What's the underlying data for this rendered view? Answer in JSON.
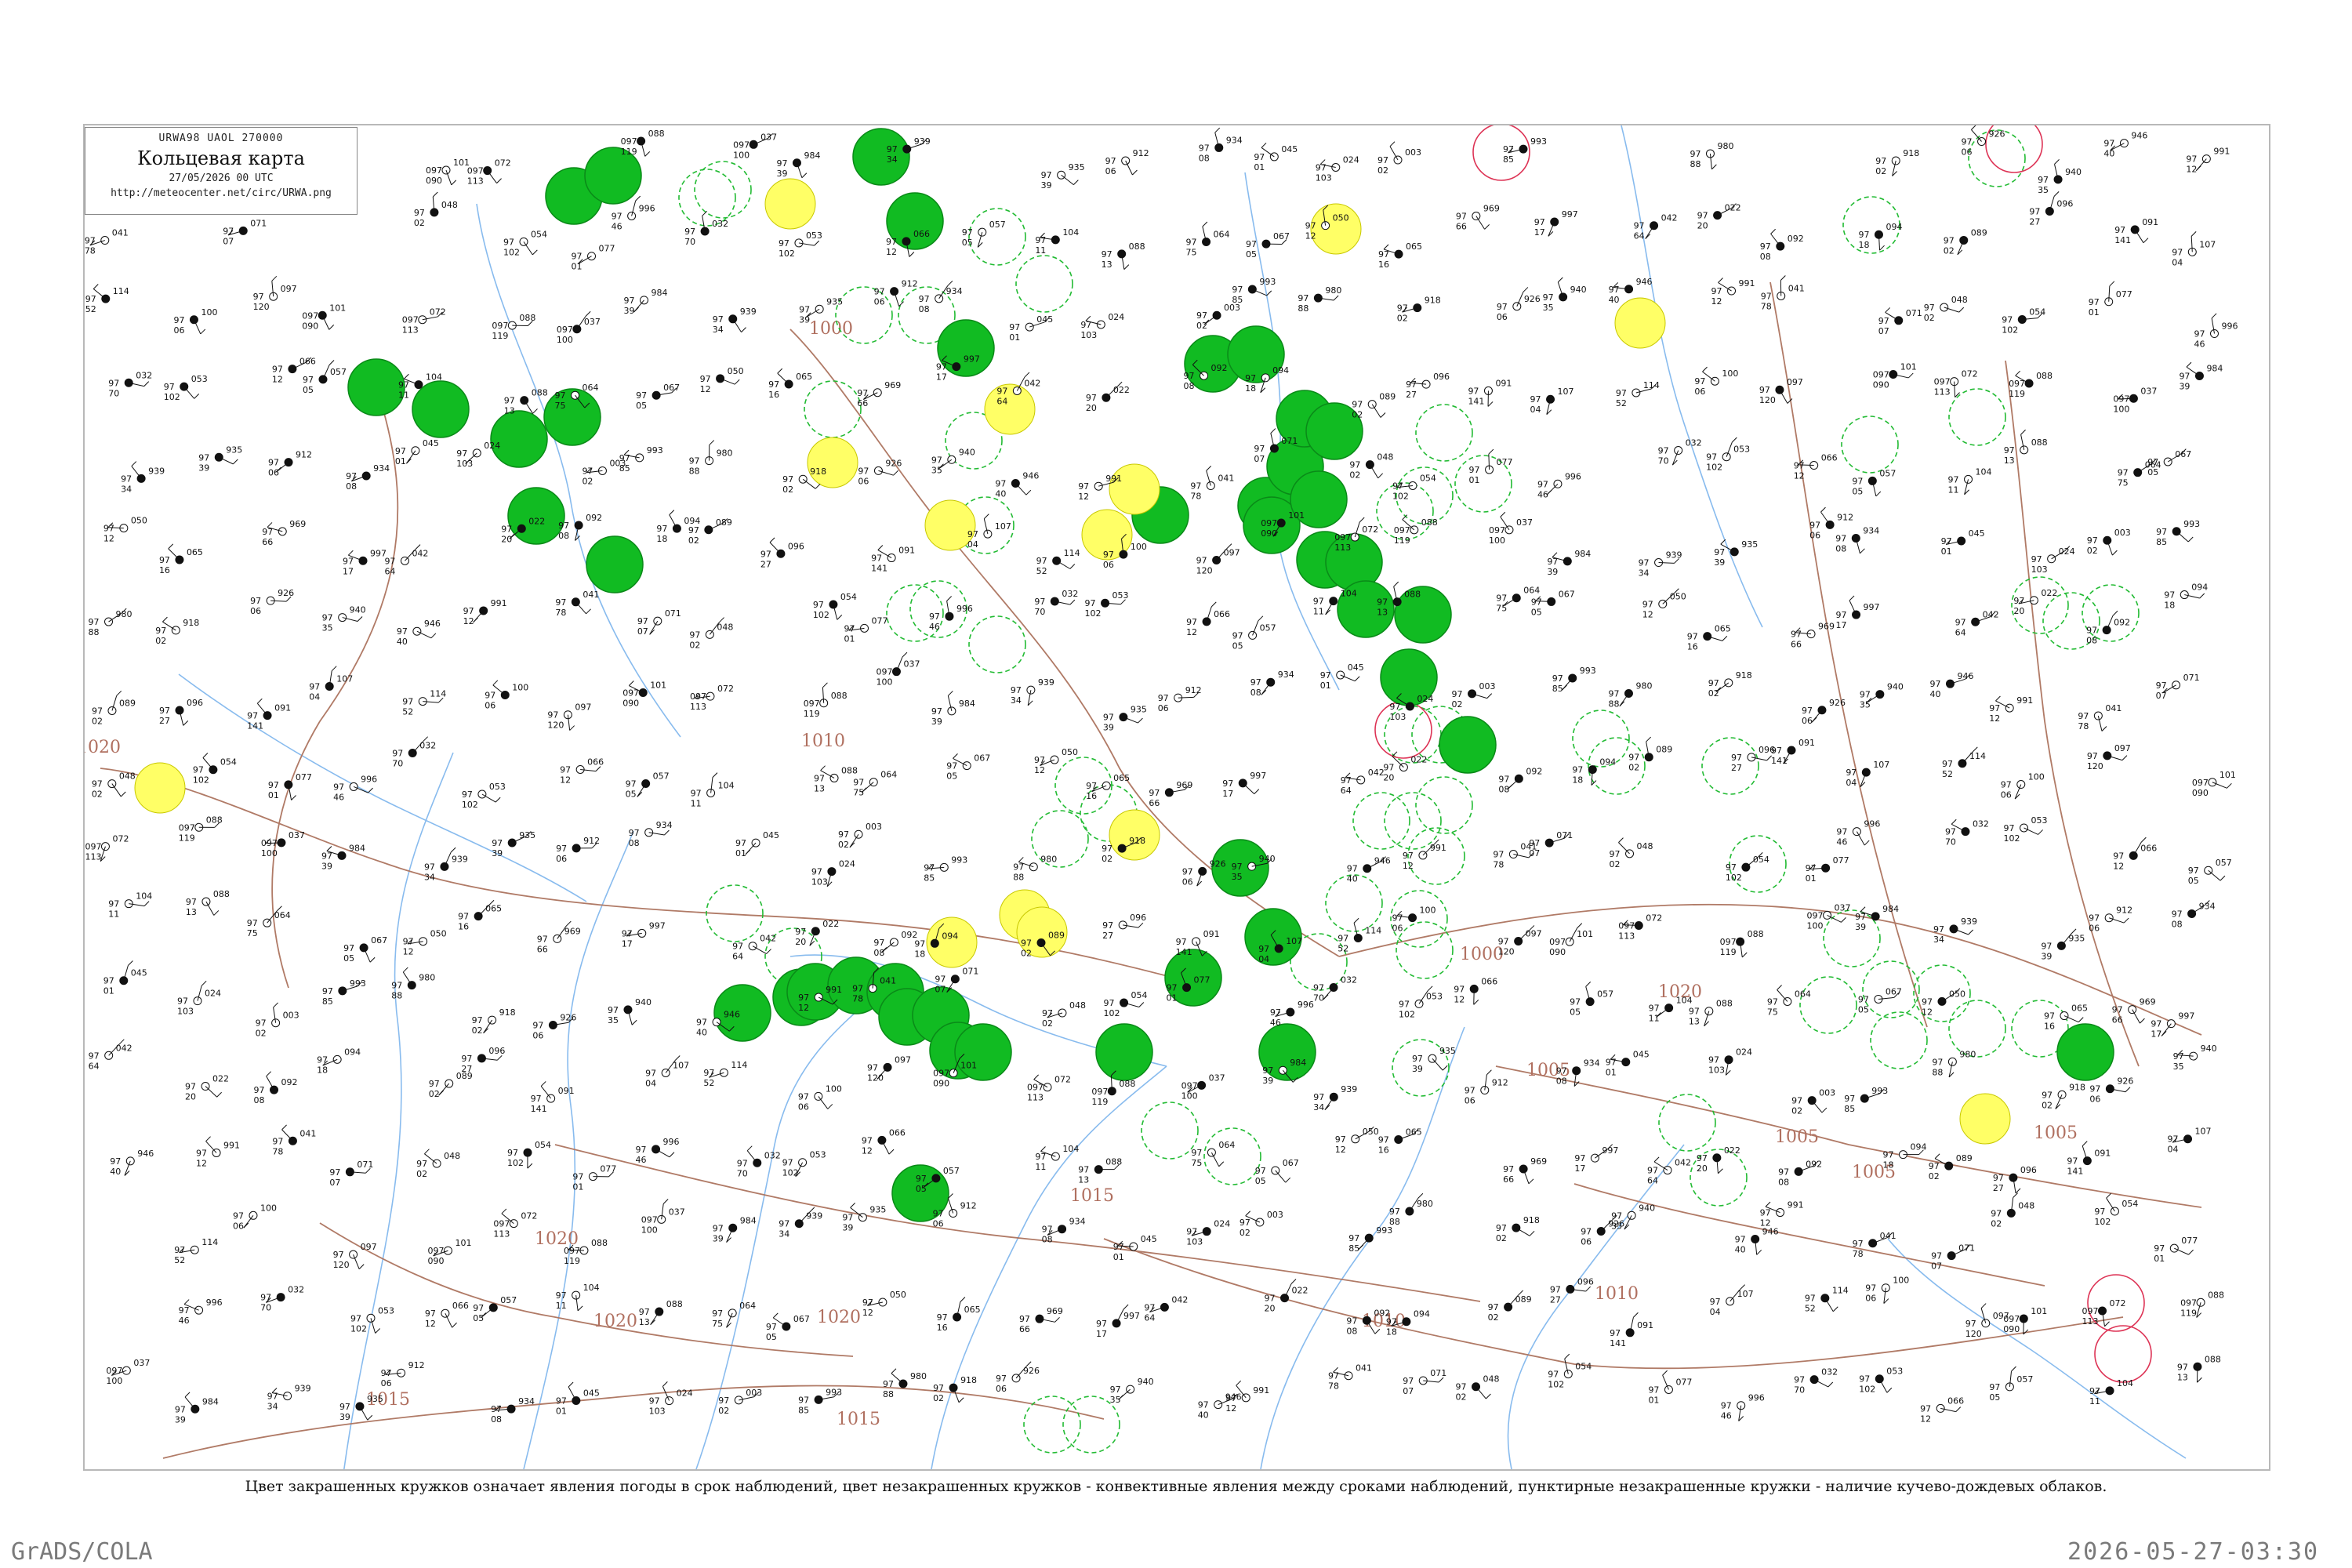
{
  "header": {
    "code": "URWA98  UAOL  270000",
    "title": "Кольцевая карта",
    "date": "27/05/2026 00 UTC",
    "url": "http://meteocenter.net/circ/URWA.png"
  },
  "caption": "Цвет закрашенных кружков означает явления погоды в срок наблюдений, цвет незакрашенных кружков - конвективные явления между сроками наблюдений, пунктирные незакрашенные кружки - наличие кучево-дождевых облаков.",
  "footer": {
    "left": "GrADS/COLA",
    "right": "2026-05-27-03:30"
  },
  "colors": {
    "green_fill": "#11bb22",
    "yellow_fill": "#ffff66",
    "isobar": "#b07a66",
    "river": "#88bbee",
    "ring_green": "#22bb33",
    "ring_red": "#dd3355"
  },
  "isobar_labels": [
    "1000",
    "1000",
    "1005",
    "1005",
    "1005",
    "1005",
    "1010",
    "1010",
    "1010",
    "1015",
    "1015",
    "1015",
    "1020",
    "1020",
    "1020",
    "1020",
    "1020"
  ],
  "stations": [
    {
      "p": "101",
      "t": "097",
      "d": "090"
    },
    {
      "p": "072",
      "t": "097",
      "d": "113"
    },
    {
      "p": "088",
      "t": "097",
      "d": "119"
    },
    {
      "p": "037",
      "t": "097",
      "d": "100"
    },
    {
      "p": "984",
      "t": "97",
      "d": "39"
    },
    {
      "p": "939",
      "t": "97",
      "d": "34"
    },
    {
      "p": "935",
      "t": "97",
      "d": "39"
    },
    {
      "p": "912",
      "t": "97",
      "d": "06"
    },
    {
      "p": "934",
      "t": "97",
      "d": "08"
    },
    {
      "p": "045",
      "t": "97",
      "d": "01"
    },
    {
      "p": "024",
      "t": "97",
      "d": "103"
    },
    {
      "p": "003",
      "t": "97",
      "d": "02"
    },
    {
      "p": "993",
      "t": "97",
      "d": "85"
    },
    {
      "p": "980",
      "t": "97",
      "d": "88"
    },
    {
      "p": "918",
      "t": "97",
      "d": "02"
    },
    {
      "p": "926",
      "t": "97",
      "d": "06"
    },
    {
      "p": "940",
      "t": "97",
      "d": "35"
    },
    {
      "p": "946",
      "t": "97",
      "d": "40"
    },
    {
      "p": "991",
      "t": "97",
      "d": "12"
    },
    {
      "p": "041",
      "t": "97",
      "d": "78"
    },
    {
      "p": "071",
      "t": "97",
      "d": "07"
    },
    {
      "p": "048",
      "t": "97",
      "d": "02"
    },
    {
      "p": "054",
      "t": "97",
      "d": "102"
    },
    {
      "p": "077",
      "t": "97",
      "d": "01"
    },
    {
      "p": "996",
      "t": "97",
      "d": "46"
    },
    {
      "p": "032",
      "t": "97",
      "d": "70"
    },
    {
      "p": "053",
      "t": "97",
      "d": "102"
    },
    {
      "p": "066",
      "t": "97",
      "d": "12"
    },
    {
      "p": "057",
      "t": "97",
      "d": "05"
    },
    {
      "p": "104",
      "t": "97",
      "d": "11"
    },
    {
      "p": "088",
      "t": "97",
      "d": "13"
    },
    {
      "p": "064",
      "t": "97",
      "d": "75"
    },
    {
      "p": "067",
      "t": "97",
      "d": "05"
    },
    {
      "p": "050",
      "t": "97",
      "d": "12"
    },
    {
      "p": "065",
      "t": "97",
      "d": "16"
    },
    {
      "p": "969",
      "t": "97",
      "d": "66"
    },
    {
      "p": "997",
      "t": "97",
      "d": "17"
    },
    {
      "p": "042",
      "t": "97",
      "d": "64"
    },
    {
      "p": "022",
      "t": "97",
      "d": "20"
    },
    {
      "p": "092",
      "t": "97",
      "d": "08"
    },
    {
      "p": "094",
      "t": "97",
      "d": "18"
    },
    {
      "p": "089",
      "t": "97",
      "d": "02"
    },
    {
      "p": "096",
      "t": "97",
      "d": "27"
    },
    {
      "p": "091",
      "t": "97",
      "d": "141"
    },
    {
      "p": "107",
      "t": "97",
      "d": "04"
    },
    {
      "p": "114",
      "t": "97",
      "d": "52"
    },
    {
      "p": "100",
      "t": "97",
      "d": "06"
    },
    {
      "p": "097",
      "t": "97",
      "d": "120"
    }
  ]
}
